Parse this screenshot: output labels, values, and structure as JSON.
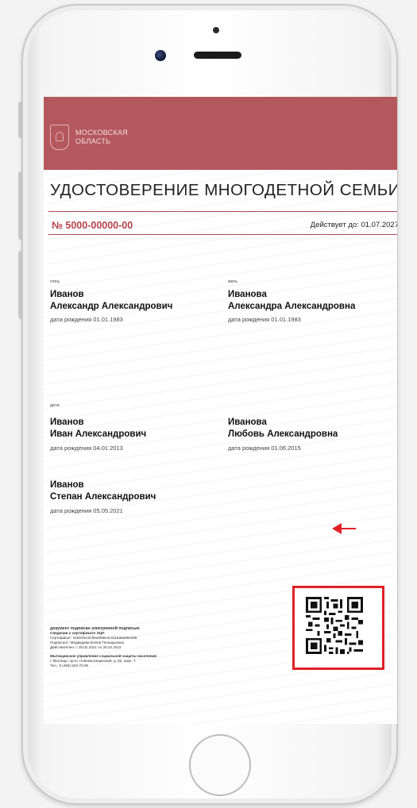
{
  "banner": {
    "region_line1": "МОСКОВСКАЯ",
    "region_line2": "ОБЛАСТЬ",
    "color": "#b5585e"
  },
  "document": {
    "title": "УДОСТОВЕРЕНИЕ МНОГОДЕТНОЙ СЕМЬИ",
    "number": "№ 5000-00000-00",
    "valid_until": "Действует до: 01.07.2027"
  },
  "parents": {
    "father": {
      "role": "отец",
      "surname": "Иванов",
      "name": "Александр Александрович",
      "dob": "дата рождения 01.01.1983"
    },
    "mother": {
      "role": "мать",
      "surname": "Иванова",
      "name": "Александра Александровна",
      "dob": "дата рождения 01.01.1983"
    }
  },
  "children": {
    "role": "дети",
    "list": [
      {
        "surname": "Иванов",
        "name": "Иван Александрович",
        "dob": "дата рождения 04.01.2013"
      },
      {
        "surname": "Иванова",
        "name": "Любовь Александровна",
        "dob": "дата рождения 01.06.2015"
      },
      {
        "surname": "Иванов",
        "name": "Степан Александрович",
        "dob": "дата рождения 05.05.2021"
      }
    ]
  },
  "signature": {
    "heading": "документ подписан электронной подписью",
    "cert_title": "Сведения о сертификате ЭЦП",
    "certificate": "Сертификат: 24591fe10cf0ad38be4c0116a5e65e295",
    "signer": "Подписант: Медведева Елена Геннадьевна",
    "valid": "Действителен: с 26.02.2021 по 26.02.2022",
    "org": "Мытищинское управление социальной защиты населения",
    "address": "г. Мытищи, пр-кт. Новомытищинский, д. 82, корп. 7",
    "phone": "Тел.: 8 (495) 502-70-80"
  },
  "accent_red": "#e02128",
  "icons": [
    "emblem-icon",
    "qr-code-icon",
    "arrow-left-icon",
    "home-button"
  ]
}
